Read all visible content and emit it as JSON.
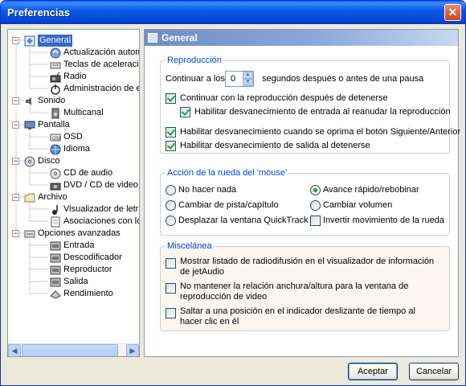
{
  "window": {
    "title": "Preferencias"
  },
  "tree": {
    "items": [
      {
        "label": "General",
        "icon": "general-icon"
      },
      {
        "label": "Actualización automátic",
        "icon": "update-icon"
      },
      {
        "label": "Teclas de aceleración",
        "icon": "keyboard-icon"
      },
      {
        "label": "Radio",
        "icon": "radio-icon"
      },
      {
        "label": "Administración de ener",
        "icon": "power-icon"
      },
      {
        "label": "Sonido",
        "icon": "sound-icon"
      },
      {
        "label": "Multicanal",
        "icon": "speaker-icon"
      },
      {
        "label": "Pantalla",
        "icon": "display-icon"
      },
      {
        "label": "OSD",
        "icon": "osd-icon"
      },
      {
        "label": "Idioma",
        "icon": "language-icon"
      },
      {
        "label": "Disco",
        "icon": "disc-icon"
      },
      {
        "label": "CD de audio",
        "icon": "cd-icon"
      },
      {
        "label": "DVD / CD de video",
        "icon": "dvd-icon"
      },
      {
        "label": "Archivo",
        "icon": "folder-icon"
      },
      {
        "label": "Visualizador de letra",
        "icon": "lyrics-icon"
      },
      {
        "label": "Asociaciones con los tip",
        "icon": "file-assoc-icon"
      },
      {
        "label": "Opciones avanzadas",
        "icon": "advanced-icon"
      },
      {
        "label": "Entrada",
        "icon": "input-icon"
      },
      {
        "label": "Descodificador",
        "icon": "decoder-icon"
      },
      {
        "label": "Reproductor",
        "icon": "player-icon"
      },
      {
        "label": "Salida",
        "icon": "output-icon"
      },
      {
        "label": "Rendimiento",
        "icon": "performance-icon"
      }
    ]
  },
  "panel": {
    "title": "General",
    "reproduccion": {
      "legend": "Reproducción",
      "continue_prefix": "Continuar a los",
      "continue_value": "0",
      "continue_suffix": "segundos después o antes de una pausa",
      "opt1": "Continuar con la reproducción después de detenerse",
      "opt2": "Habilitar desvanecimiento de entrada al reanudar la reproducción",
      "opt3": "Habilitar desvanecimiento cuando se oprima el botón Siguiente/Anterior",
      "opt4": "Habilitar desvanecimiento de salida al detenerse"
    },
    "rueda": {
      "legend": "Acción de la rueda del 'mouse'",
      "r1": "No hacer nada",
      "r2": "Avance rápido/rebobinar",
      "r3": "Cambiar de pista/capítulo",
      "r4": "Cambiar volumen",
      "r5": "Desplazar la ventana QuickTrack",
      "invert": "Invertir movimiento de la rueda"
    },
    "misc": {
      "legend": "Miscelánea",
      "m1": "Mostrar listado de radiodifusión en el visualizador de información de jetAudio",
      "m1a": "Mostrar listado de radiodifusión en el visualizador de información",
      "m1b": "de jetAudio",
      "m2a": "No mantener la relación anchura/altura para la ventana de",
      "m2b": "reproducción de video",
      "m3a": "Saltar a una posición en el indicador deslizante de tiempo al",
      "m3b": "hacer clic en él"
    }
  },
  "buttons": {
    "accept": "Aceptar",
    "cancel": "Cancelar"
  },
  "colors": {
    "legend": "#0046d5",
    "selection": "#316ac5",
    "titlebar": "#0b5ce5"
  }
}
